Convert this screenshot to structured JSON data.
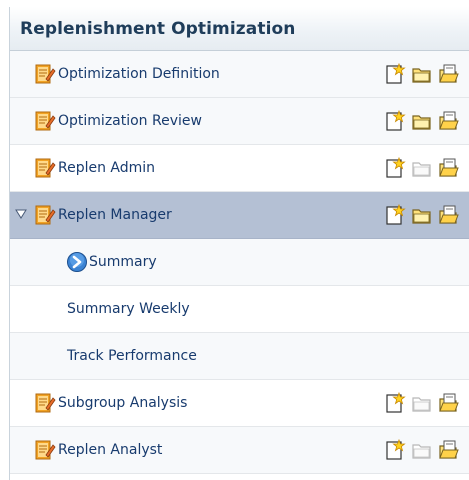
{
  "panel": {
    "title": "Replenishment Optimization"
  },
  "tasks": [
    {
      "label": "Optimization Definition",
      "open_enabled": true,
      "type": "workbook"
    },
    {
      "label": "Optimization Review",
      "open_enabled": true,
      "type": "workbook"
    },
    {
      "label": "Replen Admin",
      "open_enabled": false,
      "type": "workbook"
    },
    {
      "label": "Replen Manager",
      "open_enabled": true,
      "type": "workbook",
      "expanded": true,
      "selected": true,
      "children": [
        {
          "label": "Summary",
          "current": true
        },
        {
          "label": "Summary Weekly"
        },
        {
          "label": "Track Performance"
        }
      ]
    },
    {
      "label": "Subgroup Analysis",
      "open_enabled": false,
      "type": "workbook"
    },
    {
      "label": "Replen Analyst",
      "open_enabled": false,
      "type": "workbook"
    }
  ],
  "icons": {
    "task": "workbook-task-icon",
    "new": "new-workbook-icon",
    "open": "open-workbook-icon",
    "open_recent": "open-recent-workbook-icon",
    "expander": "expand-triangle-icon",
    "current_step": "current-step-arrow-icon"
  },
  "colors": {
    "title_text": "#1f3d5a",
    "link_text": "#183b6e",
    "selected_row": "#b4c0d4",
    "icon_orange": "#f0a020",
    "icon_yellow": "#ffe27a",
    "icon_blue": "#3a7fd0"
  }
}
